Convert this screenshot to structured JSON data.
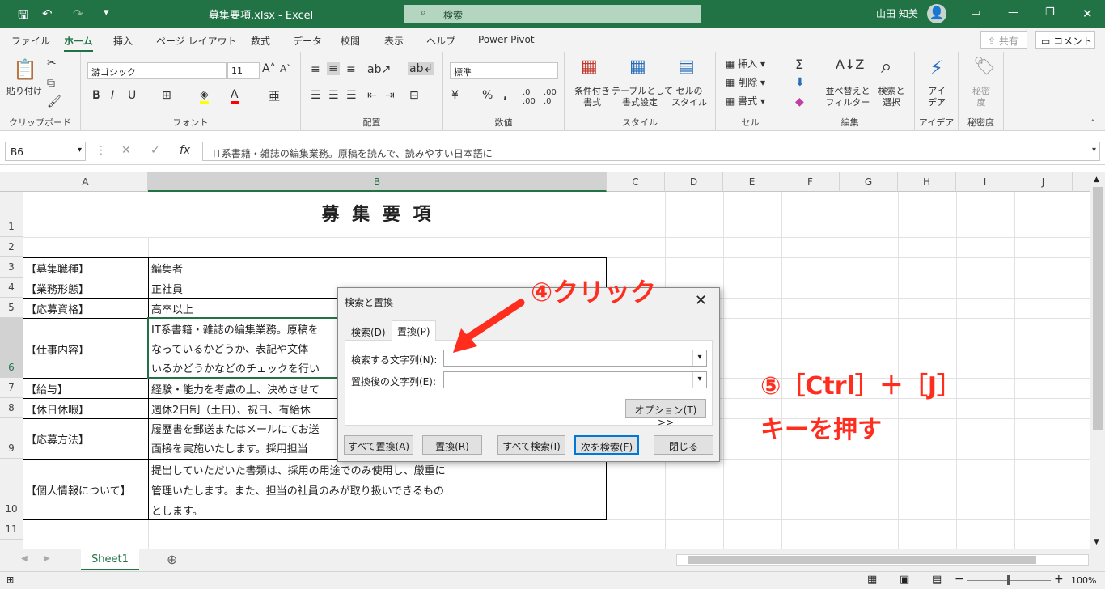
{
  "titlebar": {
    "filename": "募集要項.xlsx - Excel",
    "search": "検索",
    "user": "山田 知美"
  },
  "tabs": [
    "ファイル",
    "ホーム",
    "挿入",
    "ページ レイアウト",
    "数式",
    "データ",
    "校閲",
    "表示",
    "ヘルプ",
    "Power Pivot"
  ],
  "share": "共有",
  "comment": "コメント",
  "ribbon": {
    "clipboard": {
      "paste": "貼り付け",
      "label": "クリップボード"
    },
    "font": {
      "name": "游ゴシック",
      "size": "11",
      "label": "フォント"
    },
    "alignment": {
      "label": "配置"
    },
    "number": {
      "format": "標準",
      "label": "数値"
    },
    "styles": {
      "cond": "条件付き\n書式",
      "table": "テーブルとして\n書式設定",
      "cell": "セルの\nスタイル",
      "label": "スタイル"
    },
    "cells": {
      "insert": "挿入",
      "delete": "削除",
      "format": "書式",
      "label": "セル"
    },
    "editing": {
      "sort": "並べ替えと\nフィルター",
      "find": "検索と\n選択",
      "label": "編集"
    },
    "ideas": {
      "btn": "アイ\nデア",
      "label": "アイデア"
    },
    "sensitivity": {
      "btn": "秘密\n度",
      "label": "秘密度"
    }
  },
  "formula": {
    "namebox": "B6",
    "content": "IT系書籍・雑誌の編集業務。原稿を読んで、読みやすい日本語に"
  },
  "columns": [
    "A",
    "B",
    "C",
    "D",
    "E",
    "F",
    "G",
    "H",
    "I",
    "J"
  ],
  "rows": [
    "1",
    "2",
    "3",
    "4",
    "5",
    "6",
    "7",
    "8",
    "9",
    "10",
    "11"
  ],
  "cells": {
    "title": "募 集 要 項",
    "a3": "【募集職種】",
    "b3": "編集者",
    "a4": "【業務形態】",
    "b4": "正社員",
    "a5": "【応募資格】",
    "b5": "高卒以上",
    "a6": "【仕事内容】",
    "b6_1": "IT系書籍・雑誌の編集業務。原稿を",
    "b6_2": "なっているかどうか、表記や文体",
    "b6_3": "いるかどうかなどのチェックを行い",
    "a7": "【給与】",
    "b7": "経験・能力を考慮の上、決めさせて",
    "a8": "【休日休暇】",
    "b8": "週休2日制（土日）、祝日、有給休",
    "a9": "【応募方法】",
    "b9_1": "履歴書を郵送またはメールにてお送",
    "b9_2": "面接を実施いたします。採用担当",
    "a10": "【個人情報について】",
    "b10_1": "提出していただいた書類は、採用の用途でのみ使用し、厳重に",
    "b10_2": "管理いたします。また、担当の社員のみが取り扱いできるもの",
    "b10_3": "とします。"
  },
  "dialog": {
    "title": "検索と置換",
    "tab_find": "検索(D)",
    "tab_replace": "置換(P)",
    "find_label": "検索する文字列(N):",
    "replace_label": "置換後の文字列(E):",
    "options": "オプション(T) >>",
    "replace_all": "すべて置換(A)",
    "replace": "置換(R)",
    "find_all": "すべて検索(I)",
    "find_next": "次を検索(F)",
    "close": "閉じる"
  },
  "annotations": {
    "click": "④クリック",
    "shortcut": "⑤［Ctrl］＋［J］",
    "press": "キーを押す",
    "color": "#ff2d1e"
  },
  "sheet": {
    "tab": "Sheet1",
    "zoom": "100%"
  }
}
